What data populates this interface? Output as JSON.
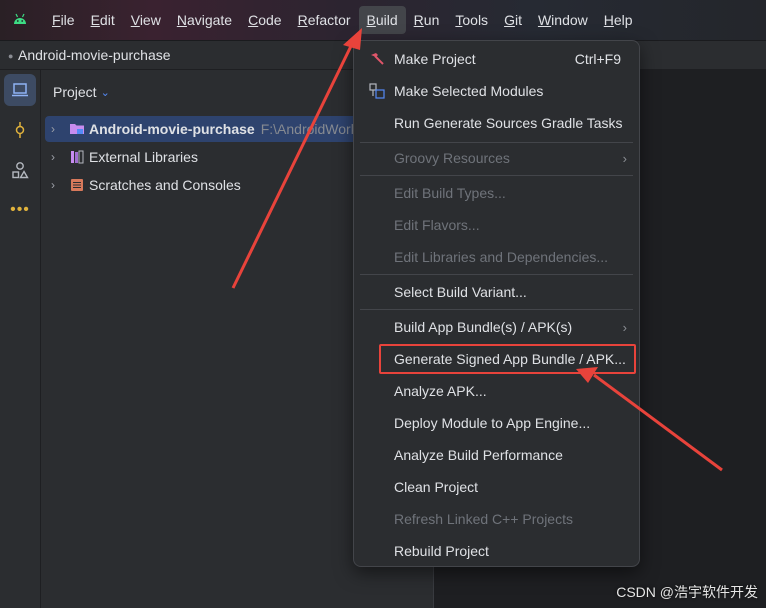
{
  "menubar": {
    "items": [
      {
        "mnemonic": "F",
        "rest": "ile"
      },
      {
        "mnemonic": "E",
        "rest": "dit"
      },
      {
        "mnemonic": "V",
        "rest": "iew"
      },
      {
        "mnemonic": "N",
        "rest": "avigate"
      },
      {
        "mnemonic": "C",
        "rest": "ode"
      },
      {
        "mnemonic": "R",
        "rest": "efactor"
      },
      {
        "mnemonic": "B",
        "rest": "uild"
      },
      {
        "mnemonic": "R",
        "rest": "un"
      },
      {
        "mnemonic": "T",
        "rest": "ools"
      },
      {
        "mnemonic": "G",
        "rest": "it"
      },
      {
        "mnemonic": "W",
        "rest": "indow"
      },
      {
        "mnemonic": "H",
        "rest": "elp"
      }
    ],
    "active_index": 6
  },
  "breadcrumb": {
    "project_name": "Android-movie-purchase"
  },
  "project_panel": {
    "title": "Project",
    "tree": [
      {
        "label": "Android-movie-purchase",
        "path": "F:\\AndroidWorkS"
      },
      {
        "label": "External Libraries"
      },
      {
        "label": "Scratches and Consoles"
      }
    ]
  },
  "build_menu": {
    "items": [
      {
        "label": "Make Project",
        "shortcut": "Ctrl+F9"
      },
      {
        "label": "Make Selected Modules"
      },
      {
        "label": "Run Generate Sources Gradle Tasks"
      },
      {
        "label": "Groovy Resources"
      },
      {
        "label": "Edit Build Types..."
      },
      {
        "label": "Edit Flavors..."
      },
      {
        "label": "Edit Libraries and Dependencies..."
      },
      {
        "label": "Select Build Variant..."
      },
      {
        "label": "Build App Bundle(s) / APK(s)"
      },
      {
        "label": "Generate Signed App Bundle / APK..."
      },
      {
        "label": "Analyze APK..."
      },
      {
        "label": "Deploy Module to App Engine..."
      },
      {
        "label": "Analyze Build Performance"
      },
      {
        "label": "Clean Project"
      },
      {
        "label": "Refresh Linked C++ Projects"
      },
      {
        "label": "Rebuild Project"
      }
    ]
  },
  "watermark": {
    "text": "CSDN @浩宇软件开发"
  },
  "colors": {
    "annotation": "#e8433b",
    "selection": "#2e436e",
    "menu_bg": "#2b2d30"
  }
}
